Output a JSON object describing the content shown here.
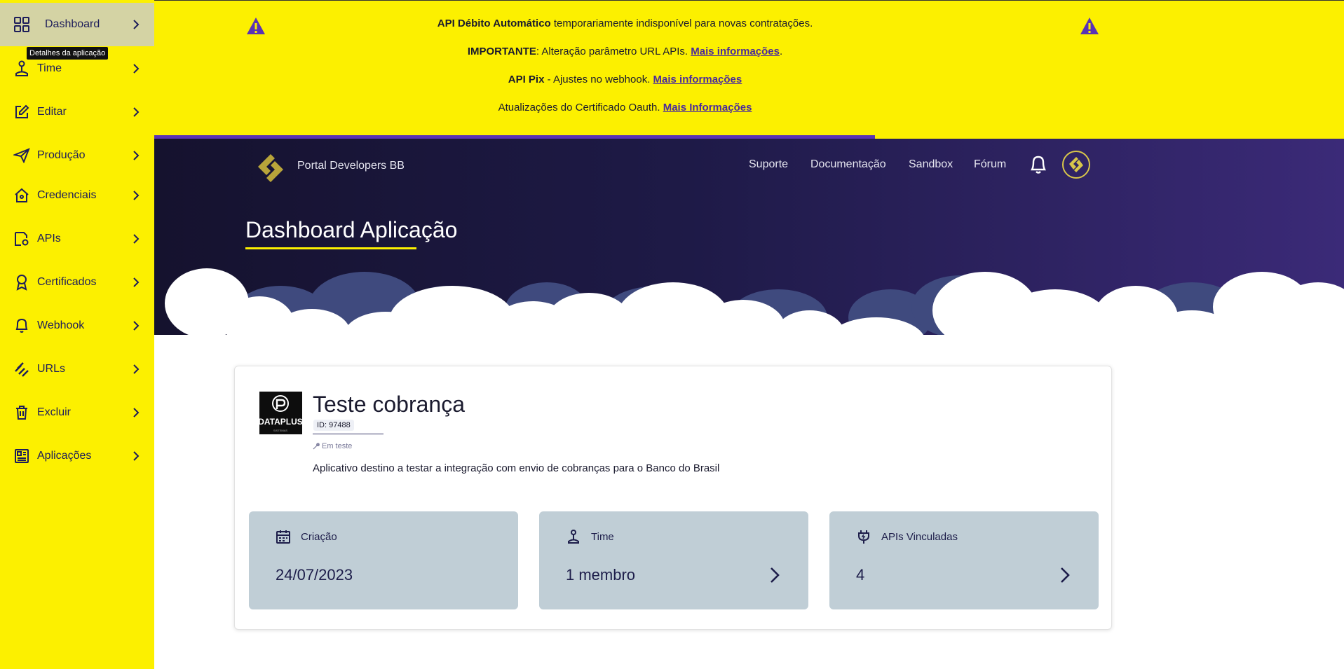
{
  "sidebar": {
    "tooltip": "Detalhes da aplicação",
    "items": [
      {
        "label": "Dashboard",
        "icon": "grid-icon"
      },
      {
        "label": "Time",
        "icon": "person-icon"
      },
      {
        "label": "Editar",
        "icon": "edit-icon"
      },
      {
        "label": "Produção",
        "icon": "paper-plane-icon"
      },
      {
        "label": "Credenciais",
        "icon": "house-key-icon"
      },
      {
        "label": "APIs",
        "icon": "api-gear-icon"
      },
      {
        "label": "Certificados",
        "icon": "ribbon-icon"
      },
      {
        "label": "Webhook",
        "icon": "bell-icon"
      },
      {
        "label": "URLs",
        "icon": "link-icon"
      },
      {
        "label": "Excluir",
        "icon": "trash-icon"
      },
      {
        "label": "Aplicações",
        "icon": "apps-icon"
      }
    ]
  },
  "banner": {
    "line1_bold": "API Débito Automático",
    "line1_text": " temporariamente indisponível para novas contratações.",
    "line2_bold": "IMPORTANTE",
    "line2_text": ": Alteração parâmetro URL APIs. ",
    "line2_link": "Mais informações",
    "line2_end": ".",
    "line3_bold": "API Pix",
    "line3_text": " - Ajustes no webhook. ",
    "line3_link": "Mais informações",
    "line4_text": "Atualizações do Certificado Oauth. ",
    "line4_link": "Mais Informações",
    "progress": 0.606
  },
  "header": {
    "portal_name": "Portal Developers BB",
    "nav": [
      "Suporte",
      "Documentação",
      "Sandbox",
      "Fórum"
    ],
    "page_title": "Dashboard Aplicação"
  },
  "app": {
    "name": "Teste cobrança",
    "id": "ID: 97488",
    "status": "Em teste",
    "description": "Aplicativo destino a testar a integração com envio de cobranças para o Banco do Brasil",
    "logo_text": "DATAPLUS",
    "logo_subtext": "SISTEMAS"
  },
  "tiles": [
    {
      "label": "Criação",
      "value": "24/07/2023",
      "icon": "calendar-icon"
    },
    {
      "label": "Time",
      "value": "1 membro",
      "icon": "person-icon"
    },
    {
      "label": "APIs Vinculadas",
      "value": "4",
      "icon": "plug-icon"
    }
  ],
  "colors": {
    "brand_yellow": "#fcf000",
    "brand_purple": "#5a33b4",
    "hero_dark": "#15122e",
    "tile_bg": "#c0ced6"
  }
}
